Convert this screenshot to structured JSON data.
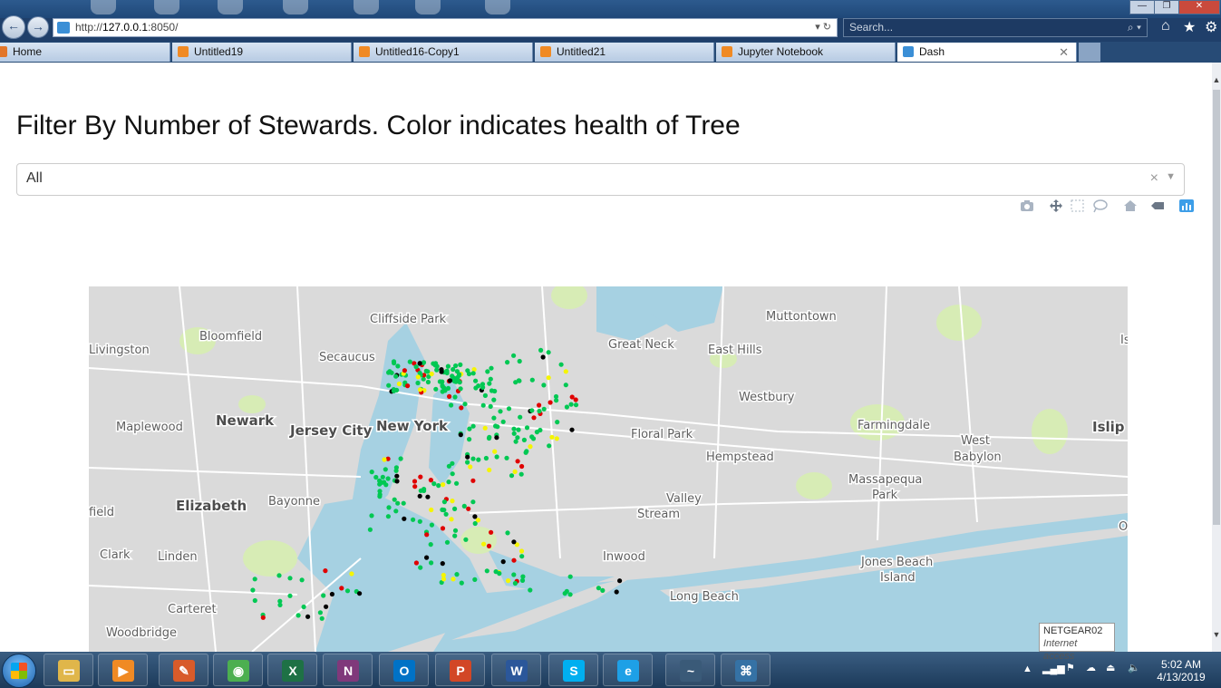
{
  "browser": {
    "url_prefix": "http://",
    "url_host": "127.0.0.1",
    "url_suffix": ":8050/",
    "search_placeholder": "Search...",
    "tabs": [
      {
        "label": "Home",
        "active": false
      },
      {
        "label": "Untitled19",
        "active": false
      },
      {
        "label": "Untitled16-Copy1",
        "active": false
      },
      {
        "label": "Untitled21",
        "active": false
      },
      {
        "label": "Jupyter Notebook",
        "active": false
      },
      {
        "label": "Dash",
        "active": true
      }
    ]
  },
  "page": {
    "title": "Filter By Number of Stewards. Color indicates health of Tree",
    "dropdown": {
      "value": "All",
      "clear_glyph": "×",
      "caret_glyph": "▼"
    }
  },
  "modebar": {
    "icons": [
      "camera-icon",
      "pan-icon",
      "box-select-icon",
      "lasso-icon",
      "home-icon",
      "hover-compare-icon",
      "plotly-logo-icon"
    ]
  },
  "map": {
    "colors": {
      "water": "#a6d1e2",
      "land": "#dadada",
      "park": "#d7ecb5",
      "road": "#ffffff",
      "good": "#00c853",
      "fair": "#f5f500",
      "poor": "#e00000",
      "dead": "#000000"
    },
    "places": [
      {
        "name": "Livingston",
        "major": false
      },
      {
        "name": "Bloomfield",
        "major": false
      },
      {
        "name": "Cliffside Park",
        "major": false
      },
      {
        "name": "Muttontown",
        "major": false
      },
      {
        "name": "Secaucus",
        "major": false
      },
      {
        "name": "Great Neck",
        "major": false
      },
      {
        "name": "East Hills",
        "major": false
      },
      {
        "name": "Westbury",
        "major": false
      },
      {
        "name": "Maplewood",
        "major": false
      },
      {
        "name": "Newark",
        "major": true
      },
      {
        "name": "Jersey City",
        "major": true
      },
      {
        "name": "New York",
        "major": true
      },
      {
        "name": "Floral Park",
        "major": false
      },
      {
        "name": "Farmingdale",
        "major": false
      },
      {
        "name": "West",
        "major": false
      },
      {
        "name": "Babylon",
        "major": false
      },
      {
        "name": "Islip",
        "major": true
      },
      {
        "name": "Hempstead",
        "major": false
      },
      {
        "name": "Massapequa",
        "major": false
      },
      {
        "name": "Park",
        "major": false
      },
      {
        "name": "Elizabeth",
        "major": true
      },
      {
        "name": "Bayonne",
        "major": false
      },
      {
        "name": "Valley",
        "major": false
      },
      {
        "name": "Stream",
        "major": false
      },
      {
        "name": "field",
        "major": false
      },
      {
        "name": "Clark",
        "major": false
      },
      {
        "name": "Linden",
        "major": false
      },
      {
        "name": "Inwood",
        "major": false
      },
      {
        "name": "Jones Beach",
        "major": false
      },
      {
        "name": "Island",
        "major": false
      },
      {
        "name": "Long Beach",
        "major": false
      },
      {
        "name": "Carteret",
        "major": false
      },
      {
        "name": "Woodbridge",
        "major": false
      },
      {
        "name": "Is",
        "major": false
      },
      {
        "name": "Oc",
        "major": false
      }
    ]
  },
  "tooltip": {
    "network": "NETGEAR02",
    "status": "Internet access"
  },
  "taskbar": {
    "apps": [
      "explorer-icon",
      "media-player-icon",
      "paint-icon",
      "chrome-icon",
      "excel-icon",
      "onenote-icon",
      "outlook-icon",
      "powerpoint-icon",
      "word-icon",
      "skype-icon",
      "ie-icon",
      "anaconda-icon",
      "python-icon"
    ],
    "time": "5:02 AM",
    "date": "4/13/2019"
  }
}
